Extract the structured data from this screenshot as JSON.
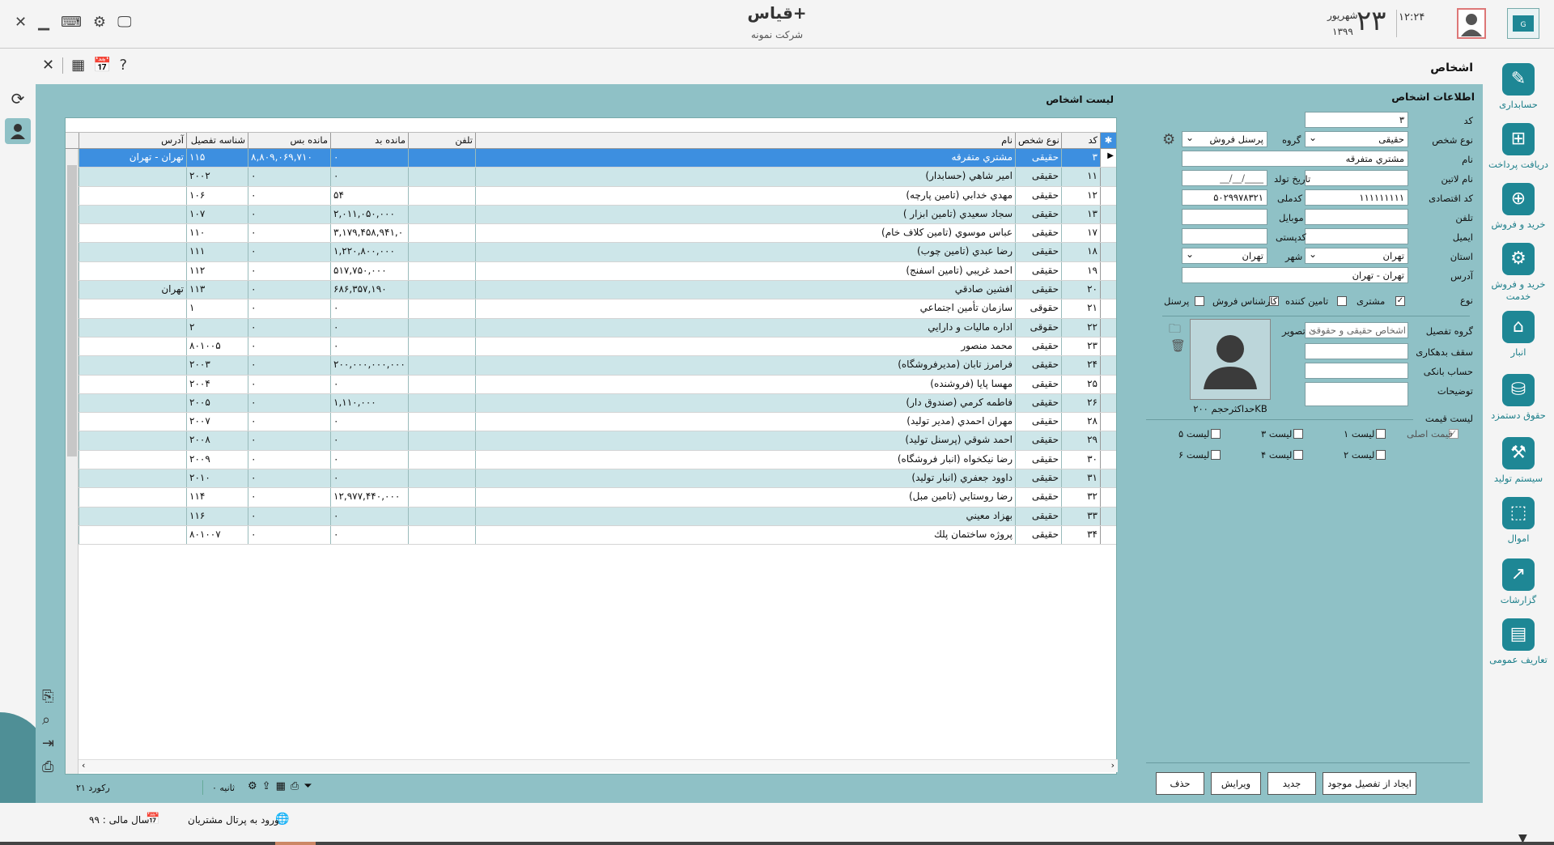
{
  "header": {
    "app_title": "قیاس+",
    "company": "شرکت نمونه",
    "time": "۱۲:۲۴",
    "day": "۲۳",
    "month": "شهریور",
    "year": "۱۳۹۹"
  },
  "page": {
    "title": "اشخاص",
    "list_title": "لیست اشخاص",
    "form_title": "اطلاعات اشخاص"
  },
  "right_nav": [
    {
      "label": "حسابداری",
      "icon": "ledger-icon"
    },
    {
      "label": "دریافت پرداخت",
      "icon": "cash-icon"
    },
    {
      "label": "خرید و فروش",
      "icon": "globe-cart-icon"
    },
    {
      "label": "خرید و فروش خدمت",
      "icon": "gear-service-icon"
    },
    {
      "label": "انبار",
      "icon": "warehouse-icon"
    },
    {
      "label": "حقوق دستمزد",
      "icon": "coins-icon"
    },
    {
      "label": "سیستم تولید",
      "icon": "factory-icon"
    },
    {
      "label": "اموال",
      "icon": "box-icon"
    },
    {
      "label": "گزارشات",
      "icon": "chart-icon"
    },
    {
      "label": "تعاریف عمومی",
      "icon": "table-icon"
    }
  ],
  "grid": {
    "columns": {
      "code": "کد",
      "type": "نوع شخص",
      "name": "نام",
      "phone": "تلفن",
      "debit": "مانده بد",
      "credit": "مانده بس",
      "detail_id": "شناسه تفصیل",
      "address": "آدرس"
    },
    "rows": [
      {
        "code": "۳",
        "type": "حقیقی",
        "name": "مشتري متفرقه",
        "phone": "",
        "debit": "۰",
        "credit": "۸,۸۰۹,۰۶۹,۷۱۰",
        "detail_id": "۱۱۵",
        "address": "تهران - تهران"
      },
      {
        "code": "۱۱",
        "type": "حقیقی",
        "name": "امیر شاهي (حسابدار)",
        "phone": "",
        "debit": "۰",
        "credit": "۰",
        "detail_id": "۲۰۰۲",
        "address": ""
      },
      {
        "code": "۱۲",
        "type": "حقیقی",
        "name": "مهدي خدابي (تامين پارچه)",
        "phone": "",
        "debit": "۵۴",
        "credit": "۰",
        "detail_id": "۱۰۶",
        "address": ""
      },
      {
        "code": "۱۳",
        "type": "حقیقی",
        "name": "سجاد سعيدي (تامين ابزار )",
        "phone": "",
        "debit": "۲,۰۱۱,۰۵۰,۰۰۰",
        "credit": "۰",
        "detail_id": "۱۰۷",
        "address": ""
      },
      {
        "code": "۱۷",
        "type": "حقیقی",
        "name": "عباس موسوي (تامين کلاف خام)",
        "phone": "",
        "debit": "۳,۱۷۹,۴۵۸,۹۴۱,۰",
        "credit": "۰",
        "detail_id": "۱۱۰",
        "address": ""
      },
      {
        "code": "۱۸",
        "type": "حقیقی",
        "name": "رضا عبدي (تامين چوب)",
        "phone": "",
        "debit": "۱,۲۲۰,۸۰۰,۰۰۰",
        "credit": "۰",
        "detail_id": "۱۱۱",
        "address": ""
      },
      {
        "code": "۱۹",
        "type": "حقیقی",
        "name": "احمد غريبي (تامين اسفنج)",
        "phone": "",
        "debit": "۵۱۷,۷۵۰,۰۰۰",
        "credit": "۰",
        "detail_id": "۱۱۲",
        "address": ""
      },
      {
        "code": "۲۰",
        "type": "حقیقی",
        "name": "افشين صادقي",
        "phone": "",
        "debit": "۶۸۶,۳۵۷,۱۹۰",
        "credit": "۰",
        "detail_id": "۱۱۳",
        "address": "تهران"
      },
      {
        "code": "۲۱",
        "type": "حقوقی",
        "name": "سازمان تأمين اجتماعي",
        "phone": "",
        "debit": "۰",
        "credit": "۰",
        "detail_id": "۱",
        "address": ""
      },
      {
        "code": "۲۲",
        "type": "حقوقی",
        "name": "اداره ماليات و دارايي",
        "phone": "",
        "debit": "۰",
        "credit": "۰",
        "detail_id": "۲",
        "address": ""
      },
      {
        "code": "۲۳",
        "type": "حقیقی",
        "name": "محمد منصور",
        "phone": "",
        "debit": "۰",
        "credit": "۰",
        "detail_id": "۸۰۱۰۰۵",
        "address": ""
      },
      {
        "code": "۲۴",
        "type": "حقیقی",
        "name": "فرامرز تابان (مديرفروشگاه)",
        "phone": "",
        "debit": "۲۰۰,۰۰۰,۰۰۰,۰۰۰",
        "credit": "۰",
        "detail_id": "۲۰۰۳",
        "address": ""
      },
      {
        "code": "۲۵",
        "type": "حقیقی",
        "name": "مهسا پايا (فروشنده)",
        "phone": "",
        "debit": "۰",
        "credit": "۰",
        "detail_id": "۲۰۰۴",
        "address": ""
      },
      {
        "code": "۲۶",
        "type": "حقیقی",
        "name": "فاطمه کرمي (صندوق دار)",
        "phone": "",
        "debit": "۱,۱۱۰,۰۰۰",
        "credit": "۰",
        "detail_id": "۲۰۰۵",
        "address": ""
      },
      {
        "code": "۲۸",
        "type": "حقیقی",
        "name": "مهران احمدي (مدير توليد)",
        "phone": "",
        "debit": "۰",
        "credit": "۰",
        "detail_id": "۲۰۰۷",
        "address": ""
      },
      {
        "code": "۲۹",
        "type": "حقیقی",
        "name": "احمد شوقي (پرسنل توليد)",
        "phone": "",
        "debit": "۰",
        "credit": "۰",
        "detail_id": "۲۰۰۸",
        "address": ""
      },
      {
        "code": "۳۰",
        "type": "حقیقی",
        "name": "رضا نيکخواه (انبار فروشگاه)",
        "phone": "",
        "debit": "۰",
        "credit": "۰",
        "detail_id": "۲۰۰۹",
        "address": ""
      },
      {
        "code": "۳۱",
        "type": "حقیقی",
        "name": "داوود جعفري (انبار توليد)",
        "phone": "",
        "debit": "۰",
        "credit": "۰",
        "detail_id": "۲۰۱۰",
        "address": ""
      },
      {
        "code": "۳۲",
        "type": "حقیقی",
        "name": "رضا روستايي (تامين مبل)",
        "phone": "",
        "debit": "۱۲,۹۷۷,۴۴۰,۰۰۰",
        "credit": "۰",
        "detail_id": "۱۱۴",
        "address": ""
      },
      {
        "code": "۳۳",
        "type": "حقیقی",
        "name": "بهزاد معيني",
        "phone": "",
        "debit": "۰",
        "credit": "۰",
        "detail_id": "۱۱۶",
        "address": ""
      },
      {
        "code": "۳۴",
        "type": "حقیقی",
        "name": "پروژه ساختمان پلك",
        "phone": "",
        "debit": "۰",
        "credit": "۰",
        "detail_id": "۸۰۱۰۰۷",
        "address": ""
      }
    ],
    "record_count": "۲۱ رکورد",
    "seconds": "۰ ثانیه"
  },
  "form": {
    "code_label": "کد",
    "code_value": "۳",
    "person_type_label": "نوع شخص",
    "person_type_value": "حقیقی",
    "group_label": "گروه",
    "group_value": "پرسنل فروش",
    "name_label": "نام",
    "name_value": "مشتري متفرقه",
    "latin_name_label": "نام لاتین",
    "birth_label": "تاریخ تولد",
    "birth_value": "__/__/____",
    "econ_code_label": "کد اقتصادی",
    "econ_code_value": "۱۱۱۱۱۱۱۱۱",
    "national_code_label": "کدملی",
    "national_code_value": "۵۰۲۹۹۷۸۳۲۱",
    "phone_label": "تلفن",
    "mobile_label": "موبایل",
    "email_label": "ایمیل",
    "postal_label": "کدپستی",
    "province_label": "استان",
    "province_value": "تهران",
    "city_label": "شهر",
    "city_value": "تهران",
    "address_label": "آدرس",
    "address_value": "تهران - تهران",
    "kind_label": "نوع",
    "kind_options": [
      {
        "label": "مشتری",
        "checked": true
      },
      {
        "label": "تامین کننده",
        "checked": false
      },
      {
        "label": "کارشناس فروش",
        "checked": false
      },
      {
        "label": "پرسنل",
        "checked": false
      }
    ],
    "detail_group_label": "گروه تفصیل",
    "detail_group_value": "اشخاص حقیقی و حقوقی",
    "image_label": "تصویر",
    "max_size": "حداکثرحجم ۲۰۰KB",
    "debt_limit_label": "سقف بدهکاری",
    "bank_label": "حساب بانکی",
    "desc_label": "توضیحات",
    "price_list_label": "لیست قیمت",
    "price_lists": [
      {
        "label": "قیمت اصلی",
        "checked": true
      },
      {
        "label": "لیست ۱",
        "checked": false
      },
      {
        "label": "لیست ۳",
        "checked": false
      },
      {
        "label": "لیست ۵",
        "checked": false
      },
      {
        "label": "لیست ۲",
        "checked": false
      },
      {
        "label": "لیست ۴",
        "checked": false
      },
      {
        "label": "لیست ۶",
        "checked": false
      }
    ],
    "buttons": {
      "create_from_detail": "ایجاد از تفصیل موجود",
      "new": "جدید",
      "edit": "ویرایش",
      "delete": "حذف"
    }
  },
  "status": {
    "fiscal_year": "سال مالی : ۹۹",
    "portal": "ورود به پرتال مشتریان"
  },
  "colors": {
    "teal_panel": "#8fc1c6",
    "accent": "#1e8795",
    "selected_row": "#3d8fe0",
    "alt_row": "#cde6e9"
  }
}
